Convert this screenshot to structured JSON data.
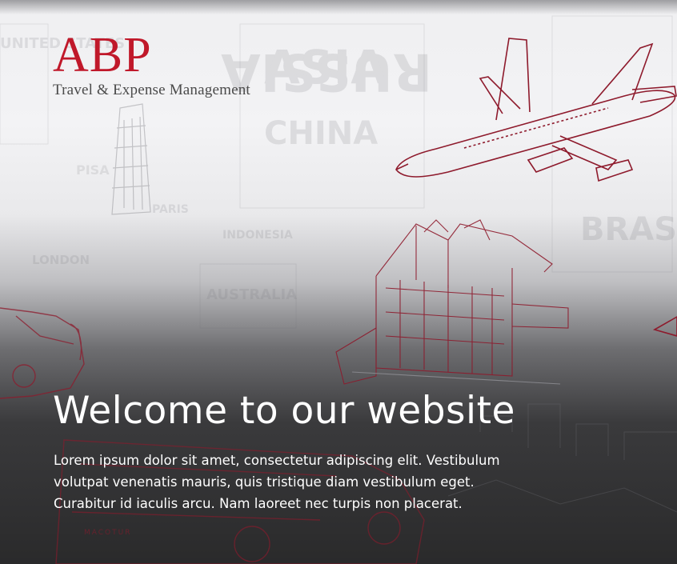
{
  "logo": {
    "mark": "ABP",
    "tagline": "Travel & Expense Management"
  },
  "hero": {
    "headline": "Welcome to our website",
    "body": "Lorem ipsum dolor sit amet, consectetur adipiscing elit. Vestibulum volutpat venenatis mauris, quis tristique diam vestibulum eget. Curabitur id iaculis arcu. Nam laoreet nec turpis non placerat."
  },
  "background": {
    "words": [
      "RUSSIA",
      "ASIA",
      "CHINA",
      "PISA",
      "PARIS",
      "LONDON",
      "UNITED STATES",
      "AUSTRALIA",
      "BRASIL",
      "INDONESIA"
    ],
    "bus_label": "MACOTUR",
    "illustrations": [
      "airplane-illustration",
      "house-illustration",
      "car-illustration",
      "bus-illustration",
      "tower-illustration"
    ]
  },
  "colors": {
    "brand": "#c0182a",
    "sketch": "#8e1a2c",
    "text_light": "#ffffff",
    "tagline": "#4a4a4a"
  }
}
